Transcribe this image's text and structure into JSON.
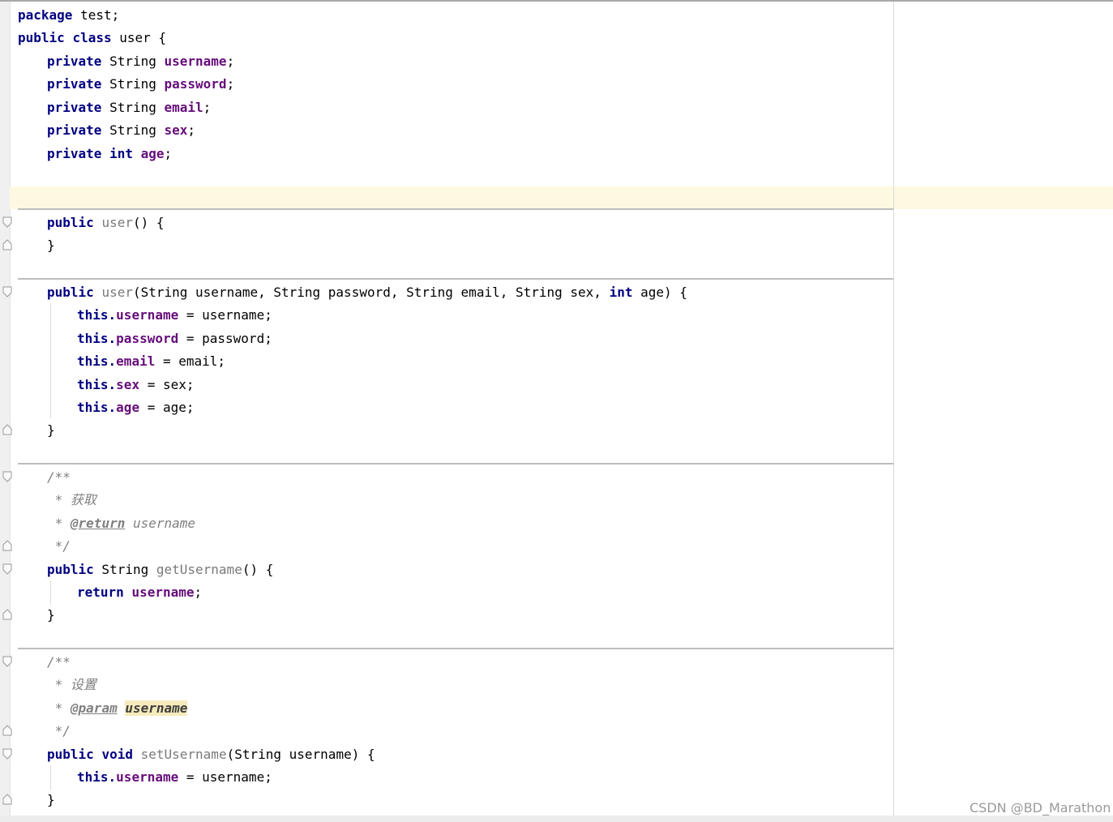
{
  "code": {
    "l1": {
      "kw": "package",
      "rest": " test;"
    },
    "l2": {
      "kw1": "public",
      "kw2": "class",
      "rest": " user {"
    },
    "fields": [
      {
        "kw": "private",
        "type": " String ",
        "name": "username",
        "end": ";"
      },
      {
        "kw": "private",
        "type": " String ",
        "name": "password",
        "end": ";"
      },
      {
        "kw": "private",
        "type": " String ",
        "name": "email",
        "end": ";"
      },
      {
        "kw": "private",
        "type": " String ",
        "name": "sex",
        "end": ";"
      }
    ],
    "age_field": {
      "kw": "private",
      "kw2": "int",
      "name": "age",
      "end": ";"
    },
    "ctor1": {
      "kw": "public",
      "name": "user",
      "rest": "() {",
      "close": "}"
    },
    "ctor2": {
      "kw": "public",
      "name": "user",
      "params": "(String username, String password, String email, String sex, ",
      "kw_int": "int",
      "params_end": " age) {",
      "close": "}",
      "assigns": [
        {
          "this": "this.",
          "field": "username",
          "rest": " = username;"
        },
        {
          "this": "this.",
          "field": "password",
          "rest": " = password;"
        },
        {
          "this": "this.",
          "field": "email",
          "rest": " = email;"
        },
        {
          "this": "this.",
          "field": "sex",
          "rest": " = sex;"
        },
        {
          "this": "this.",
          "field": "age",
          "rest": " = age;"
        }
      ]
    },
    "getter": {
      "doc_open": "/**",
      "doc_desc": " * 获取",
      "doc_star": " * ",
      "doc_tag": "@return",
      "doc_val": " username",
      "doc_close": " */",
      "kw": "public",
      "type": " String ",
      "name": "getUsername",
      "rest": "() {",
      "ret_kw": "return",
      "ret_field": "username",
      "ret_end": ";",
      "close": "}"
    },
    "setter": {
      "doc_open": "/**",
      "doc_desc": " * 设置",
      "doc_star": " * ",
      "doc_tag": "@param",
      "doc_param": "username",
      "doc_close": " */",
      "kw": "public",
      "kw2": "void",
      "name": "setUsername",
      "rest": "(String username) {",
      "this": "this.",
      "field": "username",
      "assign_rest": " = username;",
      "close": "}"
    }
  },
  "watermark": "CSDN @BD_Marathon"
}
